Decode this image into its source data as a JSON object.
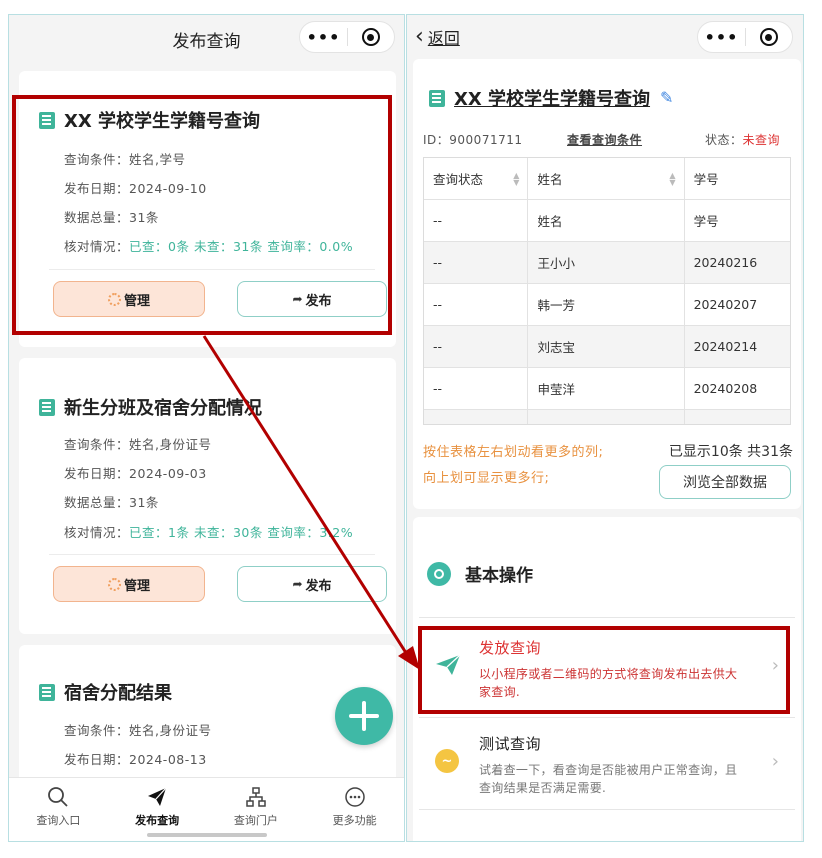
{
  "left": {
    "nav_title": "发布查询",
    "cards": [
      {
        "title": "XX 学校学生学籍号查询",
        "conditions": "查询条件：姓名,学号",
        "date": "发布日期：2024-09-10",
        "total": "数据总量：31条",
        "check_label": "核对情况：",
        "check_value": "已查：0条 未查：31条 查询率：0.0%",
        "manage_label": "管理",
        "publish_label": "发布"
      },
      {
        "title": "新生分班及宿舍分配情况",
        "conditions": "查询条件：姓名,身份证号",
        "date": "发布日期：2024-09-03",
        "total": "数据总量：31条",
        "check_label": "核对情况：",
        "check_value": "已查：1条 未查：30条 查询率：3.2%",
        "manage_label": "管理",
        "publish_label": "发布"
      },
      {
        "title": "宿舍分配结果",
        "conditions": "查询条件：姓名,身份证号",
        "date": "发布日期：2024-08-13"
      }
    ],
    "tabs": [
      {
        "label": "查询入口",
        "icon": "search-icon"
      },
      {
        "label": "发布查询",
        "icon": "paper-plane-icon"
      },
      {
        "label": "查询门户",
        "icon": "sitemap-icon"
      },
      {
        "label": "更多功能",
        "icon": "more-icon"
      }
    ]
  },
  "right": {
    "back_label": "返回",
    "title": "XX 学校学生学籍号查询",
    "id_text": "ID：900071711",
    "view_conditions": "查看查询条件",
    "status_label": "状态：",
    "status_value": "未查询",
    "table": {
      "headers": [
        "查询状态",
        "姓名",
        "学号"
      ],
      "rows": [
        [
          "--",
          "姓名",
          "学号"
        ],
        [
          "--",
          "王小小",
          "20240216"
        ],
        [
          "--",
          "韩一芳",
          "20240207"
        ],
        [
          "--",
          "刘志宝",
          "20240214"
        ],
        [
          "--",
          "申莹洋",
          "20240208"
        ]
      ]
    },
    "tip1": "按住表格左右划动看更多的列;",
    "tip2": "向上划可显示更多行;",
    "count_text": "已显示10条 共31条",
    "browse_label": "浏览全部数据",
    "section_title": "基本操作",
    "ops": [
      {
        "name": "发放查询",
        "desc": "以小程序或者二维码的方式将查询发布出去供大家查询."
      },
      {
        "name": "测试查询",
        "desc": "试着查一下，看查询是否能被用户正常查询，且查询结果是否满足需要."
      }
    ]
  },
  "colors": {
    "accent_green": "#3fb49a",
    "highlight_red": "#b20000",
    "status_red": "#d33333",
    "tip_orange": "#e8913f"
  }
}
